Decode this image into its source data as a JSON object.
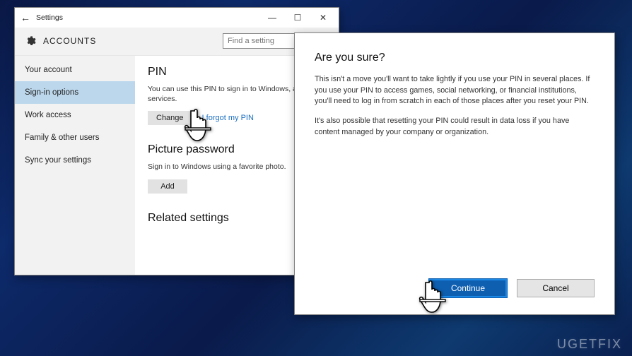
{
  "settings": {
    "titlebar": {
      "title": "Settings"
    },
    "header": {
      "title": "ACCOUNTS"
    },
    "search": {
      "placeholder": "Find a setting"
    },
    "sidebar": {
      "items": [
        {
          "label": "Your account"
        },
        {
          "label": "Sign-in options"
        },
        {
          "label": "Work access"
        },
        {
          "label": "Family & other users"
        },
        {
          "label": "Sync your settings"
        }
      ],
      "selected_index": 1
    },
    "pin": {
      "heading": "PIN",
      "desc": "You can use this PIN to sign in to Windows, apps, and services.",
      "change_label": "Change",
      "forgot_label": "I forgot my PIN"
    },
    "picture": {
      "heading": "Picture password",
      "desc": "Sign in to Windows using a favorite photo.",
      "add_label": "Add"
    },
    "related": {
      "heading": "Related settings"
    }
  },
  "dialog": {
    "title": "Are you sure?",
    "p1": "This isn't a move you'll want to take lightly if you use your PIN in several places. If you use your PIN to access games, social networking, or financial institutions, you'll need to log in from scratch in each of those places after you reset your PIN.",
    "p2": "It's also possible that resetting your PIN could result in data loss if you have content managed by your company or organization.",
    "continue_label": "Continue",
    "cancel_label": "Cancel"
  },
  "watermark": "UGETFIX"
}
